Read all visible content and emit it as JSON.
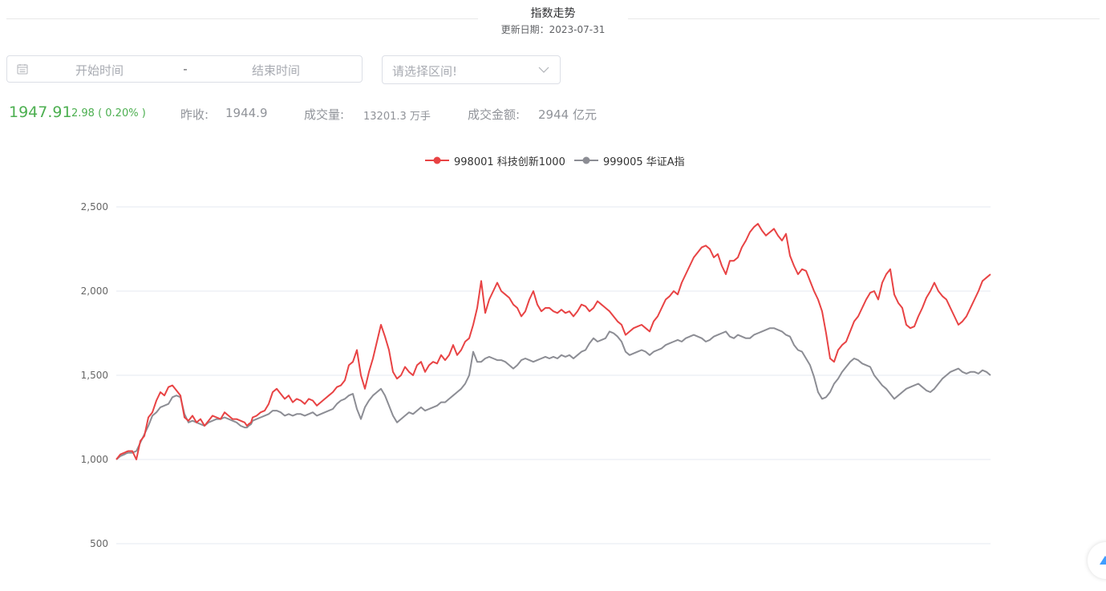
{
  "header": {
    "title": "指数走势",
    "subtitle": "更新日期：2023-07-31"
  },
  "filters": {
    "start_placeholder": "开始时间",
    "separator": "-",
    "end_placeholder": "结束时间",
    "range_select_placeholder": "请选择区间!"
  },
  "stats": {
    "price": "1947.91",
    "change": "2.98 ( 0.20% )",
    "prev_close_label": "昨收:",
    "prev_close": "1944.9",
    "volume_label": "成交量:",
    "volume": "13201.3 万手",
    "amount_label": "成交金额:",
    "amount": "2944 亿元"
  },
  "colors": {
    "up_green": "#4caf50",
    "series_red": "#e84344",
    "series_gray": "#8c8d94"
  },
  "chart_data": {
    "type": "line",
    "title": "",
    "xlabel": "",
    "ylabel": "",
    "ylim": [
      500,
      2500
    ],
    "yticks": [
      500,
      1000,
      1500,
      2000,
      2500
    ],
    "ytick_labels": [
      "500",
      "1,000",
      "1,500",
      "2,000",
      "2,500"
    ],
    "grid": true,
    "legend_position": "top-center",
    "x": [
      0,
      5,
      10,
      12,
      15,
      20,
      25,
      30,
      35,
      40,
      45,
      50,
      55,
      60,
      65,
      70,
      75,
      80,
      85,
      90,
      95,
      100,
      105,
      110,
      115,
      120,
      125,
      130,
      135,
      140,
      145,
      150,
      155,
      160,
      163,
      165,
      168,
      170,
      175,
      180,
      185,
      190,
      195,
      200,
      205,
      210,
      215,
      220,
      225,
      230,
      235,
      240,
      245,
      250,
      255,
      260,
      265,
      270,
      275,
      280,
      285,
      290,
      295,
      300,
      305,
      310,
      315,
      320,
      325,
      330,
      335,
      340,
      345,
      350,
      355,
      360,
      365,
      370,
      375,
      380,
      385,
      390,
      395,
      400,
      405,
      410,
      415,
      420,
      425,
      430,
      435,
      440,
      445,
      450,
      455,
      460,
      465,
      470,
      475,
      480,
      485,
      490,
      495,
      500,
      505,
      510,
      515,
      520,
      525,
      530,
      535,
      540,
      545,
      550,
      555,
      560,
      565,
      570,
      575,
      580,
      585,
      590,
      595,
      600,
      605,
      610,
      615,
      620,
      625,
      630,
      635,
      640,
      645,
      650,
      655,
      660,
      665,
      670,
      675,
      680,
      685,
      690,
      695,
      700,
      705,
      710,
      715,
      720,
      725,
      730,
      735,
      740,
      745,
      750,
      755,
      760,
      765,
      770,
      775,
      780,
      785,
      790,
      795,
      800,
      805,
      810,
      815,
      820,
      825,
      830,
      835,
      840,
      845,
      850,
      855,
      860,
      865,
      870,
      875,
      880,
      885,
      890,
      895,
      900,
      905,
      910,
      915,
      920,
      925,
      930,
      935,
      940,
      945,
      950,
      955,
      960,
      965,
      970,
      975,
      980,
      985,
      990,
      995,
      1000,
      1005,
      1010,
      1015,
      1020,
      1025,
      1030,
      1035,
      1040,
      1045,
      1050,
      1055,
      1060,
      1065,
      1070,
      1075,
      1080,
      1085,
      1090
    ],
    "series": [
      {
        "name": "998001 科技创新1000",
        "color": "#e84344",
        "values": [
          1000,
          1030,
          1040,
          1045,
          1050,
          1050,
          1000,
          1110,
          1140,
          1250,
          1280,
          1350,
          1400,
          1380,
          1430,
          1440,
          1410,
          1380,
          1250,
          1230,
          1260,
          1220,
          1240,
          1200,
          1230,
          1260,
          1250,
          1240,
          1280,
          1260,
          1240,
          1240,
          1230,
          1220,
          1200,
          1210,
          1220,
          1250,
          1260,
          1280,
          1290,
          1330,
          1400,
          1420,
          1390,
          1360,
          1380,
          1340,
          1360,
          1350,
          1330,
          1360,
          1350,
          1320,
          1340,
          1360,
          1380,
          1400,
          1430,
          1440,
          1470,
          1560,
          1580,
          1650,
          1500,
          1420,
          1520,
          1600,
          1700,
          1800,
          1730,
          1650,
          1520,
          1480,
          1500,
          1550,
          1520,
          1500,
          1560,
          1580,
          1520,
          1560,
          1580,
          1570,
          1620,
          1590,
          1620,
          1680,
          1620,
          1650,
          1700,
          1720,
          1800,
          1900,
          2060,
          1870,
          1950,
          2000,
          2050,
          2000,
          1980,
          1960,
          1920,
          1900,
          1850,
          1880,
          1950,
          2000,
          1920,
          1880,
          1900,
          1900,
          1880,
          1870,
          1890,
          1870,
          1880,
          1850,
          1880,
          1920,
          1910,
          1880,
          1900,
          1940,
          1920,
          1900,
          1880,
          1850,
          1820,
          1800,
          1740,
          1760,
          1780,
          1790,
          1800,
          1780,
          1760,
          1820,
          1850,
          1900,
          1950,
          1970,
          2000,
          1980,
          2050,
          2100,
          2150,
          2200,
          2230,
          2260,
          2270,
          2250,
          2200,
          2220,
          2150,
          2100,
          2180,
          2180,
          2200,
          2260,
          2300,
          2350,
          2380,
          2400,
          2360,
          2330,
          2350,
          2370,
          2330,
          2300,
          2340,
          2210,
          2150,
          2100,
          2130,
          2120,
          2060,
          2000,
          1950,
          1880,
          1750,
          1600,
          1580,
          1650,
          1680,
          1700,
          1760,
          1820,
          1850,
          1900,
          1950,
          1990,
          2000,
          1950,
          2050,
          2100,
          2130,
          1980,
          1930,
          1900,
          1800,
          1780,
          1790,
          1850,
          1900,
          1960,
          2000,
          2050,
          2000,
          1970,
          1950,
          1900,
          1850,
          1800,
          1820,
          1850,
          1900,
          1950,
          2000,
          2060,
          2080,
          2100,
          2070,
          2050,
          2060,
          2080,
          2100,
          2120,
          2150,
          2100,
          2050,
          1990,
          1980,
          2000,
          1960,
          1980,
          1990,
          2000,
          1960,
          1950,
          1940,
          1947.91
        ]
      },
      {
        "name": "999005 华证A指",
        "color": "#8c8d94",
        "values": [
          1000,
          1020,
          1030,
          1035,
          1040,
          1040,
          1050,
          1100,
          1150,
          1200,
          1260,
          1280,
          1310,
          1320,
          1330,
          1370,
          1380,
          1370,
          1270,
          1220,
          1230,
          1220,
          1210,
          1200,
          1220,
          1230,
          1240,
          1240,
          1250,
          1240,
          1230,
          1220,
          1200,
          1190,
          1190,
          1200,
          1210,
          1230,
          1240,
          1250,
          1260,
          1270,
          1290,
          1290,
          1280,
          1260,
          1270,
          1260,
          1270,
          1270,
          1260,
          1270,
          1280,
          1260,
          1270,
          1280,
          1290,
          1300,
          1330,
          1350,
          1360,
          1380,
          1390,
          1300,
          1240,
          1310,
          1350,
          1380,
          1400,
          1420,
          1380,
          1320,
          1260,
          1220,
          1240,
          1260,
          1280,
          1270,
          1290,
          1310,
          1290,
          1300,
          1310,
          1320,
          1340,
          1340,
          1360,
          1380,
          1400,
          1420,
          1450,
          1500,
          1640,
          1580,
          1580,
          1600,
          1610,
          1600,
          1590,
          1590,
          1580,
          1560,
          1540,
          1560,
          1590,
          1600,
          1590,
          1580,
          1590,
          1600,
          1610,
          1600,
          1610,
          1600,
          1620,
          1610,
          1620,
          1600,
          1620,
          1640,
          1650,
          1690,
          1720,
          1700,
          1710,
          1720,
          1760,
          1750,
          1730,
          1700,
          1640,
          1620,
          1630,
          1640,
          1650,
          1640,
          1620,
          1640,
          1650,
          1660,
          1680,
          1690,
          1700,
          1710,
          1700,
          1720,
          1730,
          1740,
          1730,
          1720,
          1700,
          1710,
          1730,
          1740,
          1750,
          1760,
          1730,
          1720,
          1740,
          1730,
          1720,
          1720,
          1740,
          1750,
          1760,
          1770,
          1780,
          1780,
          1770,
          1760,
          1740,
          1730,
          1680,
          1650,
          1640,
          1600,
          1560,
          1490,
          1400,
          1360,
          1370,
          1400,
          1450,
          1480,
          1520,
          1550,
          1580,
          1600,
          1590,
          1570,
          1560,
          1550,
          1500,
          1470,
          1440,
          1420,
          1390,
          1360,
          1380,
          1400,
          1420,
          1430,
          1440,
          1450,
          1430,
          1410,
          1400,
          1420,
          1450,
          1480,
          1500,
          1520,
          1530,
          1540,
          1520,
          1510,
          1520,
          1520,
          1510,
          1530,
          1520,
          1500,
          1480,
          1460,
          1450,
          1440,
          1430,
          1440,
          1440,
          1435,
          1440,
          1460
        ]
      }
    ]
  }
}
